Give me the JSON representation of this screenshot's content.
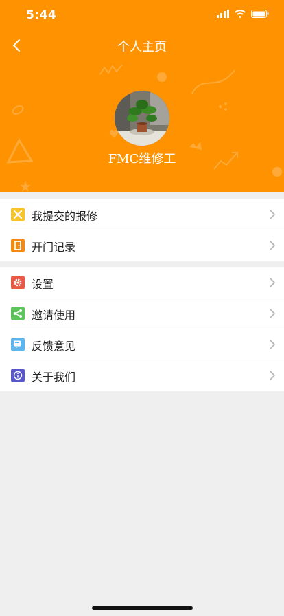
{
  "status_bar": {
    "time": "5:44",
    "icons": [
      "signal-icon",
      "wifi-icon",
      "battery-icon"
    ]
  },
  "nav": {
    "title": "个人主页",
    "back_icon": "chevron-left-icon"
  },
  "profile": {
    "name": "FMC维修工",
    "avatar": "plant-photo-avatar"
  },
  "menu_groups": [
    [
      {
        "label": "我提交的报修",
        "icon": "repair-tools-icon",
        "color": "#f5c42c"
      },
      {
        "label": "开门记录",
        "icon": "door-icon",
        "color": "#f58a12"
      }
    ],
    [
      {
        "label": "设置",
        "icon": "gear-icon",
        "color": "#e85a45"
      },
      {
        "label": "邀请使用",
        "icon": "share-icon",
        "color": "#5cc45a"
      },
      {
        "label": "反馈意见",
        "icon": "feedback-icon",
        "color": "#5bb6f0"
      },
      {
        "label": "关于我们",
        "icon": "info-icon",
        "color": "#5a58c8"
      }
    ]
  ],
  "colors": {
    "header_bg": "#ff9200",
    "page_bg": "#efefef"
  }
}
